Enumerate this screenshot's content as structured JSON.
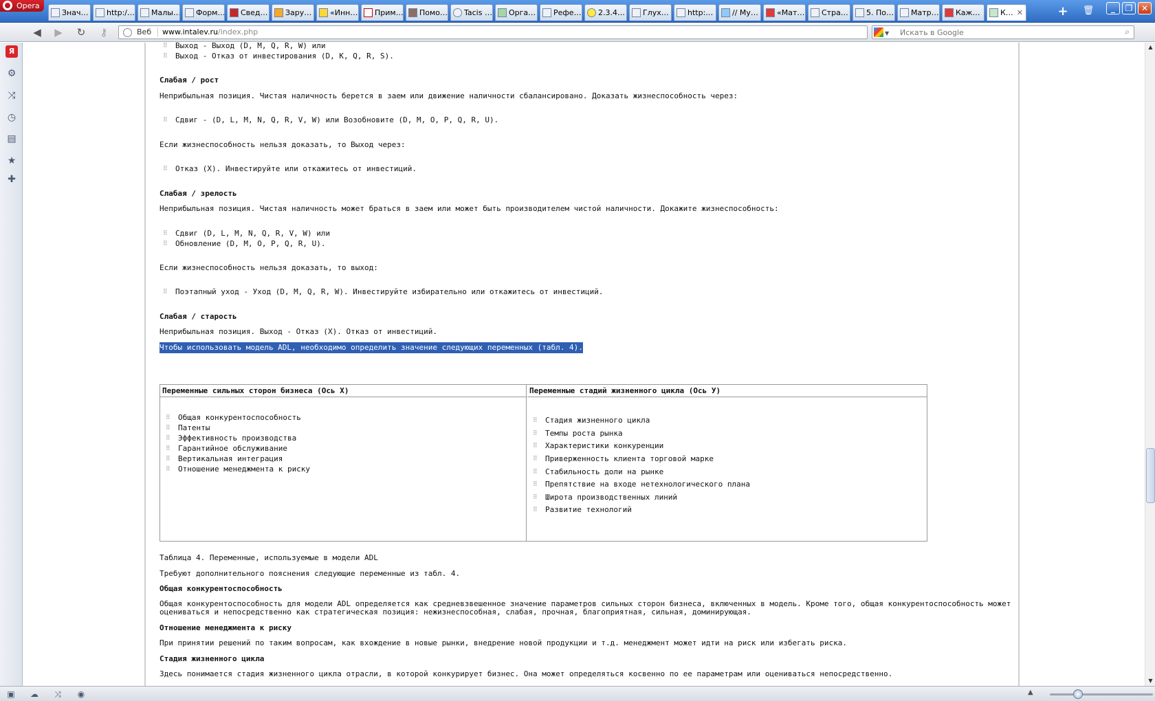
{
  "browser": {
    "menu_label": "Opera",
    "tabs": [
      {
        "label": "Знач…"
      },
      {
        "label": "http:/…"
      },
      {
        "label": "Малы…"
      },
      {
        "label": "Форм…"
      },
      {
        "label": "Свед…"
      },
      {
        "label": "Зару…"
      },
      {
        "label": "«Инн…"
      },
      {
        "label": "Прим…"
      },
      {
        "label": "Помо…"
      },
      {
        "label": "Tacis …"
      },
      {
        "label": "Орга…"
      },
      {
        "label": "Рефе…"
      },
      {
        "label": "2.3.4…"
      },
      {
        "label": "Глух…"
      },
      {
        "label": "http:…"
      },
      {
        "label": "// Му…"
      },
      {
        "label": "«Мат…"
      },
      {
        "label": "Стра…"
      },
      {
        "label": "5. По…"
      },
      {
        "label": "Матр…"
      },
      {
        "label": "Каж…"
      },
      {
        "label": "К…"
      }
    ],
    "active_tab_close": "✕",
    "new_tab": "+",
    "window_min": "_",
    "window_max": "❐",
    "window_close": "✕"
  },
  "addressbar": {
    "url_label": "Веб",
    "url_host": "www.intalev.ru",
    "url_path": "/index.php",
    "search_placeholder": "Искать в Google"
  },
  "article": {
    "lines_top": [
      "Выход - Выход (D, M, Q, R, W) или",
      "Выход - Отказ от инвестирования (D, K, Q, R, S)."
    ],
    "h_weak_growth": "Слабая / рост",
    "p_weak_growth": "Неприбыльная позиция. Чистая наличность берется в заем или движение наличности сбалансировано. Доказать жизнеспособность через:",
    "b_weak_growth_1": "Сдвиг - (D, L, M, N, Q, R, V, W) или Возобновите (D, M, O, P, Q, R, U).",
    "p_weak_growth_2": "Если жизнеспособность нельзя доказать, то Выход через:",
    "b_weak_growth_2": "Отказ (X). Инвестируйте или откажитесь от инвестиций.",
    "h_weak_maturity": "Слабая / зрелость",
    "p_weak_maturity": "Неприбыльная позиция. Чистая наличность может браться в заем или может быть производителем чистой наличности. Докажите жизнеспособность:",
    "b_weak_maturity_1": "Сдвиг (D, L, M, N, Q, R, V, W) или",
    "b_weak_maturity_2": "Обновление (D, M, O, P, Q, R, U).",
    "p_weak_maturity_2": "Если жизнеспособность нельзя доказать, то выход:",
    "b_weak_maturity_3": "Поэтапный уход - Уход (D, M, Q, R, W). Инвестируйте избирательно или откажитесь от инвестиций.",
    "h_weak_old": "Слабая / старость",
    "p_weak_old": "Неприбыльная позиция. Выход - Отказ (X). Отказ от инвестиций.",
    "p_selected": "Чтобы использовать модель ADL, необходимо определить значение следующих переменных (табл. 4).",
    "table": {
      "col1_header": "Переменные сильных сторон бизнеса (Ось Х)",
      "col2_header": "Переменные стадий жизненного цикла (Ось У)",
      "col1_items": [
        "Общая конкурентоспособность",
        "Патенты",
        "Эффективность производства",
        "Гарантийное обслуживание",
        "Вертикальная интеграция",
        "Отношение менеджмента к риску"
      ],
      "col2_items": [
        "Стадия жизненного цикла",
        "Темпы роста рынка",
        "Характеристики конкуренции",
        "Приверженность клиента торговой марке",
        "Стабильность доли на рынке",
        "Препятствие на входе нетехнологического плана",
        "Широта производственных линий",
        "Развитие технологий"
      ]
    },
    "caption": "Таблица 4. Переменные, используемые в модели ADL",
    "p_explain": "Требуют дополнительного пояснения следующие переменные из табл. 4.",
    "h_competitiveness": "Общая конкурентоспособность",
    "p_competitiveness_1": "Общая конкурентоспособность для модели ADL определяется как средневзвешенное значение параметров сильных сторон бизнеса, включенных в модель. Кроме того, общая конкурентоспособность может",
    "p_competitiveness_2": "оцениваться и непосредственно как стратегическая позиция: нежизнеспособная, слабая, прочная, благоприятная, сильная, доминирующая.",
    "h_risk": "Отношение менеджмента к риску",
    "p_risk": "При принятии решений по таким вопросам, как вхождение в новые рынки, внедрение новой продукции и т.д. менеджмент может идти на риск или избегать риска.",
    "h_lifecycle": "Стадия жизненного цикла",
    "p_lifecycle": "Здесь понимается стадия жизненного цикла отрасли, в которой конкурирует бизнес. Она может определяться косвенно по ее параметрам или оцениваться непосредственно."
  }
}
